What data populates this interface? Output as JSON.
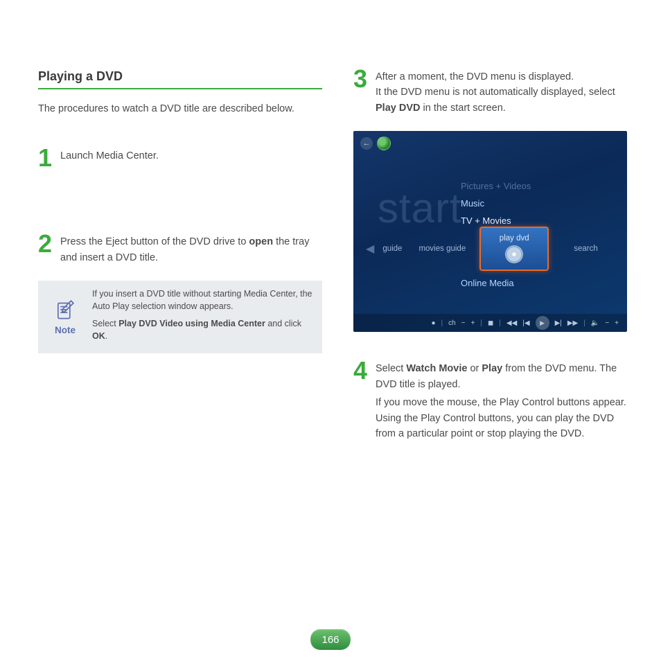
{
  "title": "Playing a DVD",
  "lead": "The procedures to watch a DVD title are described below.",
  "steps": {
    "s1": {
      "num": "1",
      "text": "Launch Media Center."
    },
    "s2": {
      "num": "2",
      "text_a": "Press the Eject button of the DVD drive to ",
      "bold_a": "open",
      "text_b": " the tray and insert a DVD title."
    },
    "s3": {
      "num": "3",
      "line1": "After a moment, the DVD menu is displayed.",
      "line2a": "It the DVD menu is not automatically displayed, select ",
      "line2b": "Play DVD",
      "line2c": " in the start screen."
    },
    "s4": {
      "num": "4",
      "a1": "Select ",
      "b1": "Watch Movie",
      "a2": " or ",
      "b2": "Play",
      "a3": " from the DVD menu. The DVD title is played.",
      "rest": "If you move the mouse, the Play Control buttons appear. Using the Play Control buttons, you can play the DVD from a particular point or stop playing the DVD."
    }
  },
  "note": {
    "label": "Note",
    "p1": "If you insert a DVD title without starting Media Center, the Auto Play selection window appears.",
    "p2a": "Select ",
    "p2b": "Play DVD Video using Media Center",
    "p2c": " and click ",
    "p2d": "OK",
    "p2e": "."
  },
  "shot": {
    "start": "start",
    "pic": "Pictures + Videos",
    "music": "Music",
    "tv": "TV + Movies",
    "guide": "guide",
    "movies_guide": "movies guide",
    "play_dvd": "play dvd",
    "search": "search",
    "online": "Online Media",
    "ch": "ch",
    "minus": "−",
    "plus": "+",
    "sep": "|",
    "stop": "◼",
    "rew": "◀◀",
    "prev": "|◀",
    "play": "▶",
    "next": "▶|",
    "fwd": "▶▶",
    "vol": "🔈",
    "back_arrow": "←"
  },
  "page": "166"
}
